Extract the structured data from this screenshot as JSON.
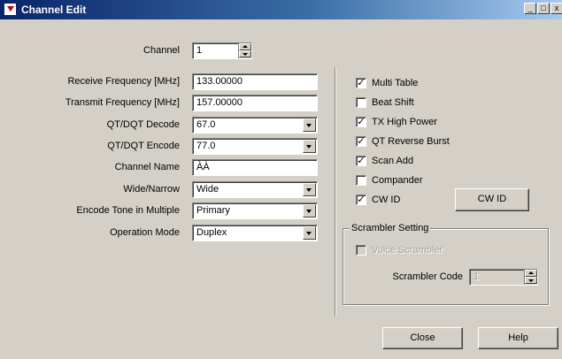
{
  "window": {
    "title": "Channel Edit",
    "minimize_glyph": "_",
    "maximize_glyph": "□",
    "close_glyph": "x"
  },
  "form": {
    "channel": {
      "label": "Channel",
      "value": "1"
    },
    "receive_frequency": {
      "label": "Receive Frequency [MHz]",
      "value": "133.00000"
    },
    "transmit_frequency": {
      "label": "Transmit Frequency [MHz]",
      "value": "157.00000"
    },
    "qt_dqt_decode": {
      "label": "QT/DQT Decode",
      "value": "67.0"
    },
    "qt_dqt_encode": {
      "label": "QT/DQT Encode",
      "value": "77.0"
    },
    "channel_name": {
      "label": "Channel Name",
      "value": "ÀÀ"
    },
    "wide_narrow": {
      "label": "Wide/Narrow",
      "value": "Wide"
    },
    "encode_tone_multiple": {
      "label": "Encode Tone in Multiple",
      "value": "Primary"
    },
    "operation_mode": {
      "label": "Operation Mode",
      "value": "Duplex"
    }
  },
  "options": {
    "check_glyph": "✓",
    "multi_table": {
      "label": "Multi Table",
      "checked": true
    },
    "beat_shift": {
      "label": "Beat Shift",
      "checked": false
    },
    "tx_high_power": {
      "label": "TX High Power",
      "checked": true
    },
    "qt_reverse_burst": {
      "label": "QT Reverse Burst",
      "checked": true
    },
    "scan_add": {
      "label": "Scan Add",
      "checked": true
    },
    "compander": {
      "label": "Compander",
      "checked": false
    },
    "cw_id": {
      "label": "CW ID",
      "checked": true
    },
    "cw_id_button": "CW ID"
  },
  "scrambler": {
    "title": "Scrambler Setting",
    "voice_scrambler": {
      "label": "Voice Scrambler",
      "checked": false,
      "enabled": false
    },
    "code": {
      "label": "Scrambler Code",
      "value": "1",
      "enabled": false
    }
  },
  "buttons": {
    "close": "Close",
    "help": "Help"
  }
}
